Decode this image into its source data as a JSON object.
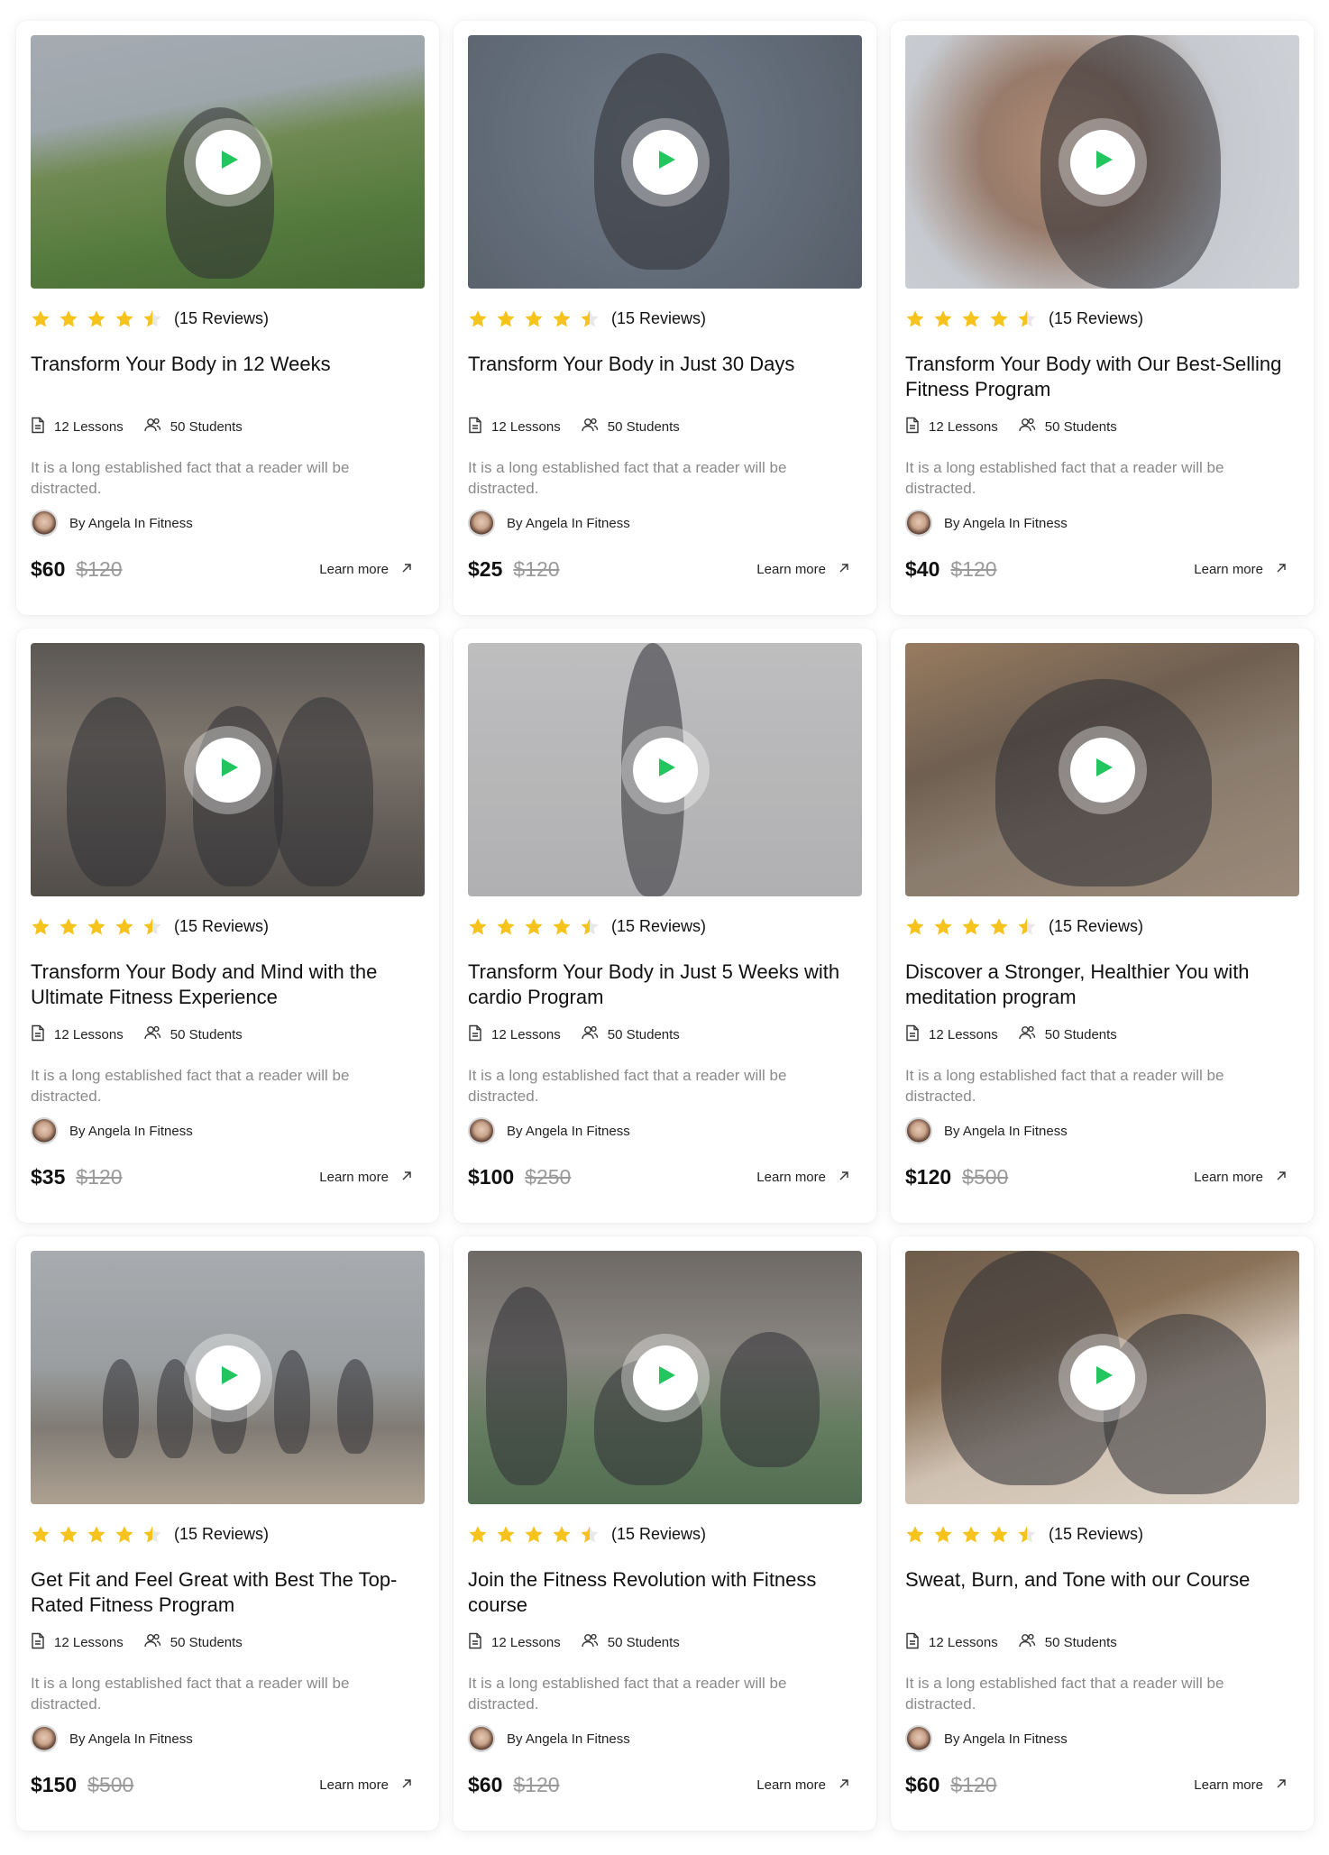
{
  "colors": {
    "star": "#f6c21c",
    "play": "#22c55e",
    "muted_text": "#8a8a8a",
    "price_old": "#9a9a9a"
  },
  "icons": {
    "rating": "star-icon",
    "play": "play-icon",
    "lessons": "document-icon",
    "students": "users-icon",
    "learn_more": "arrow-up-right-icon"
  },
  "courses": [
    {
      "rating": 4.5,
      "reviews": "(15 Reviews)",
      "title": "Transform Your Body in 12 Weeks",
      "lessons": "12 Lessons",
      "students": "50 Students",
      "description": "It is a long established fact that a reader will be distracted.",
      "author": "By Angela In Fitness",
      "price": "$60",
      "old_price": "$120",
      "cta": "Learn more"
    },
    {
      "rating": 4.5,
      "reviews": "(15 Reviews)",
      "title": "Transform Your Body in Just 30 Days",
      "lessons": "12 Lessons",
      "students": "50 Students",
      "description": "It is a long established fact that a reader will be distracted.",
      "author": "By Angela In Fitness",
      "price": "$25",
      "old_price": "$120",
      "cta": "Learn more"
    },
    {
      "rating": 4.5,
      "reviews": "(15 Reviews)",
      "title": "Transform Your Body with Our Best-Selling Fitness Program",
      "lessons": "12 Lessons",
      "students": "50 Students",
      "description": "It is a long established fact that a reader will be distracted.",
      "author": "By Angela In Fitness",
      "price": "$40",
      "old_price": "$120",
      "cta": "Learn more"
    },
    {
      "rating": 4.5,
      "reviews": "(15 Reviews)",
      "title": "Transform Your Body and Mind with the Ultimate Fitness Experience",
      "lessons": "12 Lessons",
      "students": "50 Students",
      "description": "It is a long established fact that a reader will be distracted.",
      "author": "By Angela In Fitness",
      "price": "$35",
      "old_price": "$120",
      "cta": "Learn more"
    },
    {
      "rating": 4.5,
      "reviews": "(15 Reviews)",
      "title": "Transform Your Body in Just 5 Weeks with cardio Program",
      "lessons": "12 Lessons",
      "students": "50 Students",
      "description": "It is a long established fact that a reader will be distracted.",
      "author": "By Angela In Fitness",
      "price": "$100",
      "old_price": "$250",
      "cta": "Learn more"
    },
    {
      "rating": 4.5,
      "reviews": "(15 Reviews)",
      "title": "Discover a Stronger, Healthier You with meditation program",
      "lessons": "12 Lessons",
      "students": "50 Students",
      "description": "It is a long established fact that a reader will be distracted.",
      "author": "By Angela In Fitness",
      "price": "$120",
      "old_price": "$500",
      "cta": "Learn more"
    },
    {
      "rating": 4.5,
      "reviews": "(15 Reviews)",
      "title": "Get Fit and Feel Great with Best The Top-Rated Fitness Program",
      "lessons": "12 Lessons",
      "students": "50 Students",
      "description": "It is a long established fact that a reader will be distracted.",
      "author": "By Angela In Fitness",
      "price": "$150",
      "old_price": "$500",
      "cta": "Learn more"
    },
    {
      "rating": 4.5,
      "reviews": "(15 Reviews)",
      "title": "Join the Fitness Revolution with Fitness course",
      "lessons": "12 Lessons",
      "students": "50 Students",
      "description": "It is a long established fact that a reader will be distracted.",
      "author": "By Angela In Fitness",
      "price": "$60",
      "old_price": "$120",
      "cta": "Learn more"
    },
    {
      "rating": 4.5,
      "reviews": "(15 Reviews)",
      "title": "Sweat, Burn, and Tone with our Course",
      "lessons": "12 Lessons",
      "students": "50 Students",
      "description": "It is a long established fact that a reader will be distracted.",
      "author": "By Angela In Fitness",
      "price": "$60",
      "old_price": "$120",
      "cta": "Learn more"
    }
  ]
}
